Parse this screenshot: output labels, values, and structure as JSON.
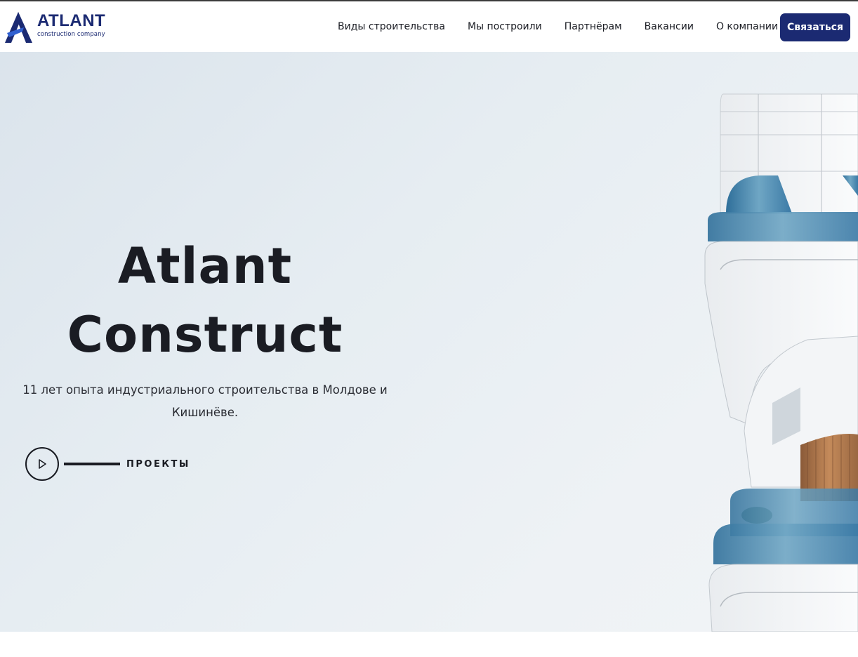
{
  "brand": {
    "name": "ATLANT",
    "tagline": "construction company",
    "color": "#1b2a72"
  },
  "nav": {
    "items": [
      {
        "label": "Виды строительства"
      },
      {
        "label": "Мы построили"
      },
      {
        "label": "Партнёрам"
      },
      {
        "label": "Вакансии"
      },
      {
        "label": "О компании"
      }
    ],
    "cta_label": "Связаться"
  },
  "hero": {
    "title_line1": "Atlant",
    "title_line2": "Construct",
    "subtitle": "11 лет опыта индустриального строительства в Молдове и Кишинёве.",
    "projects_label": "ПРОЕКТЫ",
    "background_image": "modern white building with curved balconies against a pale sky"
  },
  "icons": {
    "logo": "atlant-a-logo-icon",
    "play": "play-icon"
  },
  "colors": {
    "accent": "#1b2a72",
    "text": "#1a1c23",
    "sky": "#e6edf2"
  }
}
